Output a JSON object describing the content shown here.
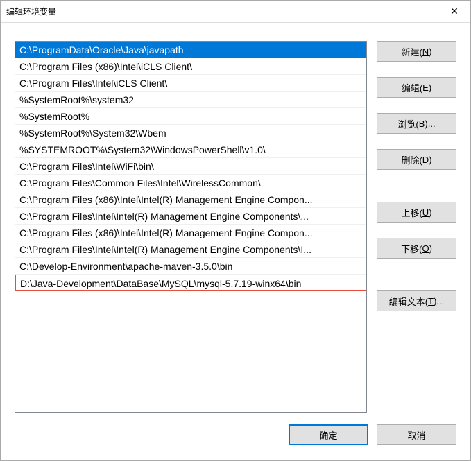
{
  "title": "编辑环境变量",
  "list": {
    "items": [
      "C:\\ProgramData\\Oracle\\Java\\javapath",
      "C:\\Program Files (x86)\\Intel\\iCLS Client\\",
      "C:\\Program Files\\Intel\\iCLS Client\\",
      "%SystemRoot%\\system32",
      "%SystemRoot%",
      "%SystemRoot%\\System32\\Wbem",
      "%SYSTEMROOT%\\System32\\WindowsPowerShell\\v1.0\\",
      "C:\\Program Files\\Intel\\WiFi\\bin\\",
      "C:\\Program Files\\Common Files\\Intel\\WirelessCommon\\",
      "C:\\Program Files (x86)\\Intel\\Intel(R) Management Engine Compon...",
      "C:\\Program Files\\Intel\\Intel(R) Management Engine Components\\...",
      "C:\\Program Files (x86)\\Intel\\Intel(R) Management Engine Compon...",
      "C:\\Program Files\\Intel\\Intel(R) Management Engine Components\\I...",
      "C:\\Develop-Environment\\apache-maven-3.5.0\\bin",
      "D:\\Java-Development\\DataBase\\MySQL\\mysql-5.7.19-winx64\\bin"
    ],
    "selected_index": 0,
    "highlighted_index": 14
  },
  "buttons": {
    "new": {
      "label": "新建(",
      "shortcut": "N",
      "suffix": ")"
    },
    "edit": {
      "label": "编辑(",
      "shortcut": "E",
      "suffix": ")"
    },
    "browse": {
      "label": "浏览(",
      "shortcut": "B",
      "suffix": ")..."
    },
    "delete": {
      "label": "删除(",
      "shortcut": "D",
      "suffix": ")"
    },
    "moveup": {
      "label": "上移(",
      "shortcut": "U",
      "suffix": ")"
    },
    "movedown": {
      "label": "下移(",
      "shortcut": "O",
      "suffix": ")"
    },
    "edittext": {
      "label": "编辑文本(",
      "shortcut": "T",
      "suffix": ")..."
    }
  },
  "footer": {
    "ok": "确定",
    "cancel": "取消"
  }
}
